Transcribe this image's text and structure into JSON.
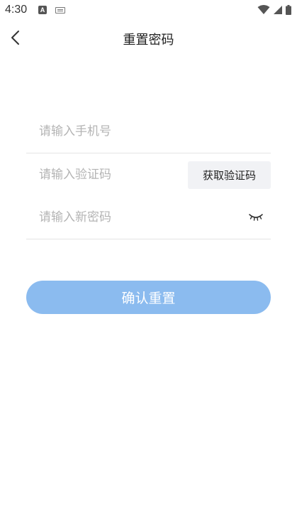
{
  "status_bar": {
    "time": "4:30",
    "notification_icons": [
      "a-icon",
      "keyboard-icon"
    ],
    "system_icons": [
      "wifi-icon",
      "signal-icon",
      "battery-icon"
    ]
  },
  "header": {
    "title": "重置密码",
    "back_icon": "chevron-left-icon"
  },
  "form": {
    "phone_placeholder": "请输入手机号",
    "code_placeholder": "请输入验证码",
    "get_code_label": "获取验证码",
    "password_placeholder": "请输入新密码",
    "password_toggle_icon": "eye-closed-icon",
    "submit_label": "确认重置"
  },
  "colors": {
    "primary_button": "#8bbbef",
    "code_button_bg": "#f1f2f5",
    "divider": "#e4e4e4",
    "placeholder": "#b4b4b4"
  }
}
